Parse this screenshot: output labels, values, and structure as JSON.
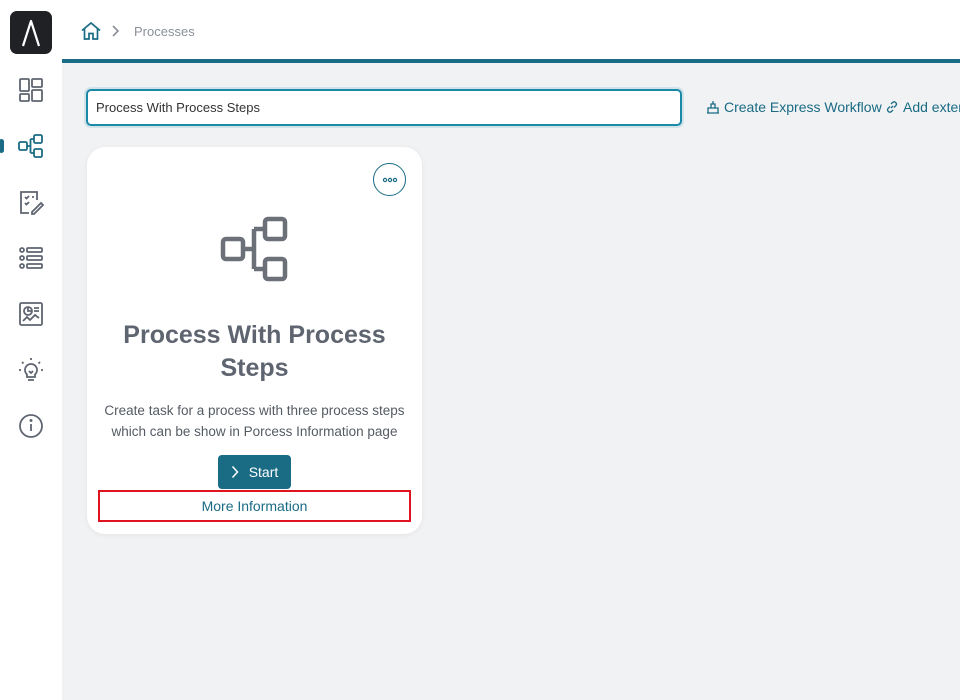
{
  "breadcrumb": {
    "current": "Processes"
  },
  "search": {
    "value": "Process With Process Steps"
  },
  "actions": {
    "create_express_workflow": "Create Express Workflow",
    "add_external": "Add exter"
  },
  "card": {
    "title": "Process With Process Steps",
    "description": "Create task for a process with three process steps which can be show in Porcess Information page",
    "start_label": "Start",
    "more_info_label": "More Information"
  },
  "sidebar": {
    "items": [
      {
        "icon": "dashboard-icon"
      },
      {
        "icon": "process-icon",
        "active": true
      },
      {
        "icon": "checklist-icon"
      },
      {
        "icon": "list-icon"
      },
      {
        "icon": "report-icon"
      },
      {
        "icon": "lightbulb-icon"
      },
      {
        "icon": "info-icon"
      }
    ]
  },
  "colors": {
    "accent": "#1a6b84",
    "highlight": "#e0141e",
    "logo_bg": "#1f2125"
  }
}
